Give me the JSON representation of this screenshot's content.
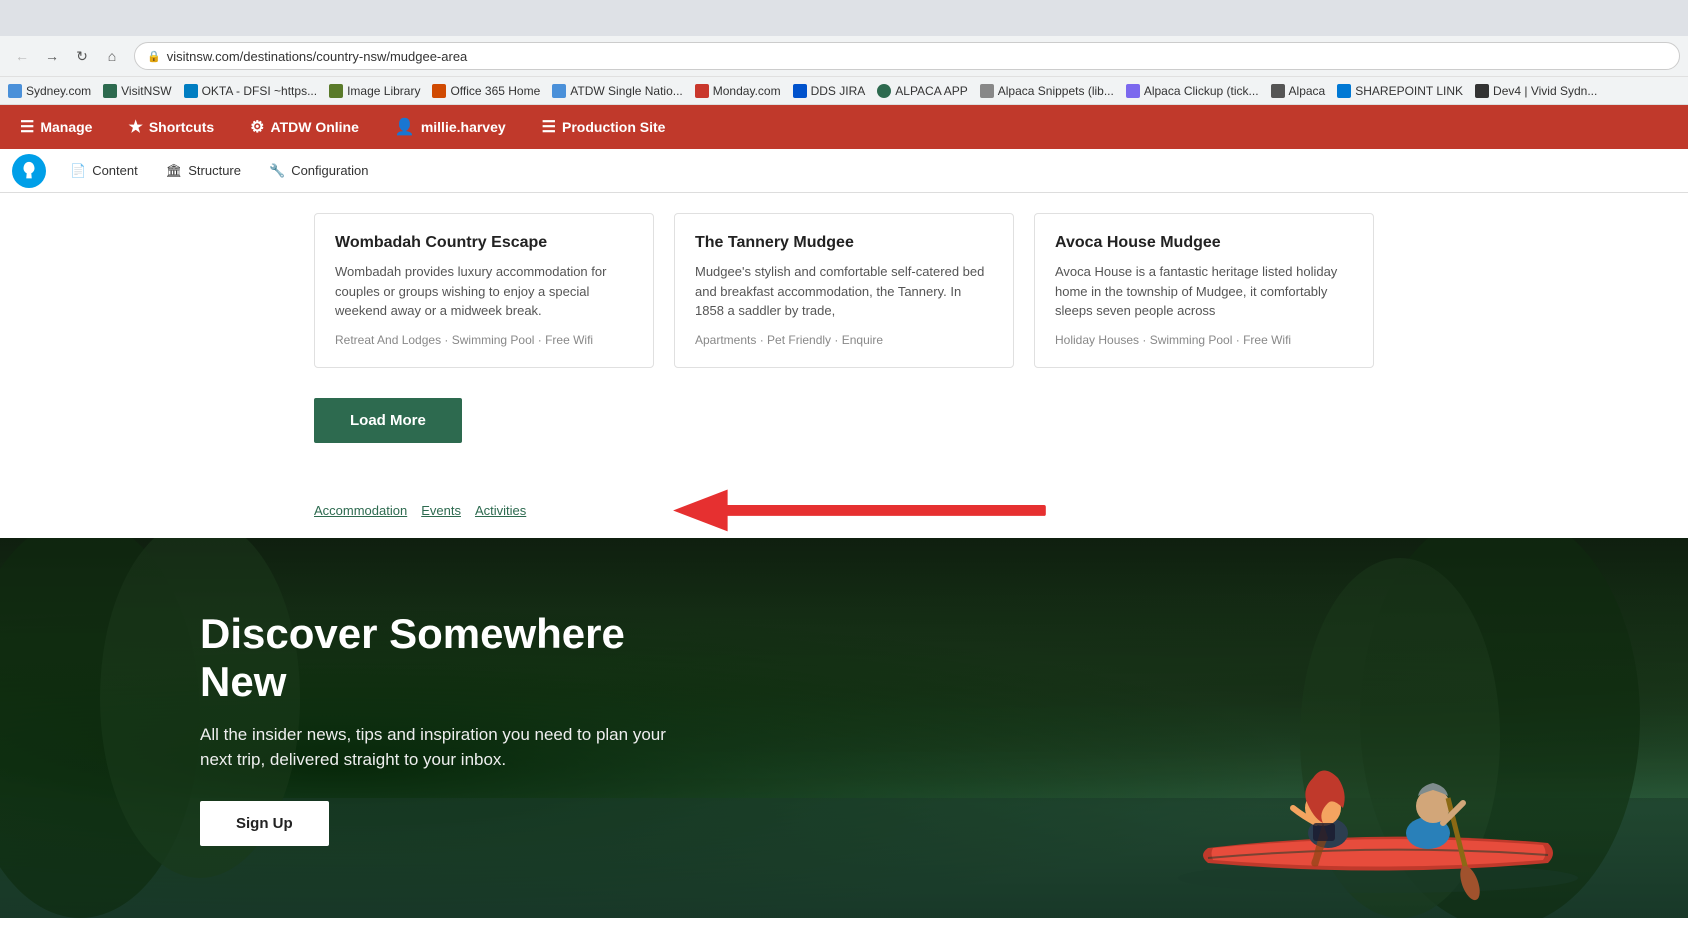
{
  "browser": {
    "url": "visitnsw.com/destinations/country-nsw/mudgee-area",
    "tabs": [
      {
        "label": "Sydney.com",
        "favicon_color": "#4a90d9",
        "active": false
      },
      {
        "label": "VisitNSW",
        "favicon_color": "#2d6a4f",
        "active": false
      },
      {
        "label": "OKTA - DFSI ~https...",
        "favicon_color": "#007dc1",
        "active": false
      },
      {
        "label": "Image Library",
        "favicon_color": "#5a7a2a",
        "active": false
      },
      {
        "label": "Office 365 Home",
        "favicon_color": "#d04a02",
        "active": false
      },
      {
        "label": "ATDW Single Natio...",
        "favicon_color": "#4a90d9",
        "active": false
      },
      {
        "label": "Monday.com",
        "favicon_color": "#c9372c",
        "active": false
      },
      {
        "label": "DDS JIRA",
        "favicon_color": "#0052cc",
        "active": false
      },
      {
        "label": "ALPACA APP",
        "favicon_color": "#2d6a4f",
        "active": false
      },
      {
        "label": "Alpaca Snippets (lib...",
        "favicon_color": "#888",
        "active": false
      },
      {
        "label": "Alpaca Clickup (tick...",
        "favicon_color": "#7b68ee",
        "active": false
      },
      {
        "label": "Alpaca",
        "favicon_color": "#555",
        "active": false
      },
      {
        "label": "SHAREPOINT LINK",
        "favicon_color": "#0078d4",
        "active": false
      },
      {
        "label": "Dev4 | Vivid Sydn...",
        "favicon_color": "#333",
        "active": true
      }
    ],
    "bookmarks": [
      {
        "label": "Sydney.com",
        "favicon_color": "#4a90d9"
      },
      {
        "label": "VisitNSW",
        "favicon_color": "#2d6a4f"
      },
      {
        "label": "OKTA - DFSI ~https...",
        "favicon_color": "#007dc1"
      },
      {
        "label": "Image Library",
        "favicon_color": "#5a7a2a"
      },
      {
        "label": "Office 365 Home",
        "favicon_color": "#d04a02"
      },
      {
        "label": "ATDW Single Natio...",
        "favicon_color": "#4a90d9"
      },
      {
        "label": "Monday.com",
        "favicon_color": "#c9372c"
      },
      {
        "label": "DDS JIRA",
        "favicon_color": "#0052cc"
      },
      {
        "label": "ALPACA APP",
        "favicon_color": "#2d6a4f"
      },
      {
        "label": "Alpaca Snippets (lib...",
        "favicon_color": "#888"
      },
      {
        "label": "Alpaca Clickup (tick...",
        "favicon_color": "#7b68ee"
      },
      {
        "label": "Alpaca",
        "favicon_color": "#555"
      },
      {
        "label": "SHAREPOINT LINK",
        "favicon_color": "#0078d4"
      },
      {
        "label": "Dev4 | Vivid Sydn",
        "favicon_color": "#333"
      }
    ]
  },
  "admin_bar": {
    "items": [
      {
        "label": "Manage",
        "icon": "☰"
      },
      {
        "label": "Shortcuts",
        "icon": "★"
      },
      {
        "label": "ATDW Online",
        "icon": "⚙"
      },
      {
        "label": "millie.harvey",
        "icon": "👤"
      },
      {
        "label": "Production Site",
        "icon": "☰"
      }
    ]
  },
  "drupal_nav": {
    "items": [
      {
        "label": "Content",
        "icon": "📄"
      },
      {
        "label": "Structure",
        "icon": "🏛"
      },
      {
        "label": "Configuration",
        "icon": "🔧"
      }
    ]
  },
  "cards": [
    {
      "title": "Wombadah Country Escape",
      "description": "Wombadah provides luxury accommodation for couples or groups wishing to enjoy a special weekend away or a midweek break.",
      "tags": "Retreat And Lodges · Swimming Pool · Free Wifi"
    },
    {
      "title": "The Tannery Mudgee",
      "description": "Mudgee's stylish and comfortable self-catered bed and breakfast accommodation, the Tannery. In 1858 a saddler by trade,",
      "tags": "Apartments · Pet Friendly · Enquire"
    },
    {
      "title": "Avoca House Mudgee",
      "description": "Avoca House is a fantastic heritage listed holiday home in the township of Mudgee, it comfortably sleeps seven people across",
      "tags": "Holiday Houses · Swimming Pool · Free Wifi"
    }
  ],
  "load_more_btn": "Load More",
  "filter_links": [
    {
      "label": "Accommodation"
    },
    {
      "label": "Events"
    },
    {
      "label": "Activities"
    }
  ],
  "hero": {
    "title": "Discover Somewhere New",
    "subtitle": "All the insider news, tips and inspiration you need to plan your next trip, delivered straight to your inbox.",
    "sign_up_btn": "Sign Up"
  }
}
